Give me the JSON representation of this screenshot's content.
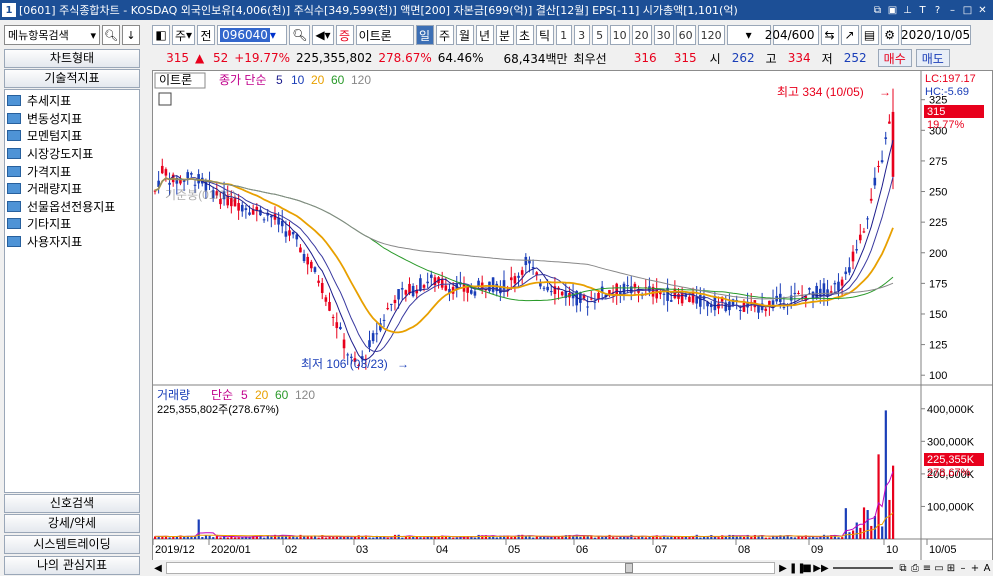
{
  "window": {
    "number": "1",
    "title": "[0601] 주식종합차트 - KOSDAQ 외국인보유[4,006(천)] 주식수[349,599(천)] 액면[200] 자본금[699(억)] 결산[12월] EPS[-11] 시가총액[1,101(억)"
  },
  "left_panel": {
    "menu_search_placeholder": "메뉴항목검색",
    "chart_type_label": "차트형태",
    "technical_label": "기술적지표",
    "tree_items": [
      "추세지표",
      "변동성지표",
      "모멘텀지표",
      "시장강도지표",
      "가격지표",
      "거래량지표",
      "선물옵션전용지표",
      "기타지표",
      "사용자지표"
    ],
    "signal_search": "신호검색",
    "strong_weak": "강세/약세",
    "system_trading": "시스템트레이딩",
    "my_indicators": "나의 관심지표"
  },
  "toolbar": {
    "ju": "주",
    "jeon": "전",
    "code": "096040",
    "name": "이트론",
    "jeung": "증",
    "periods": [
      "일",
      "주",
      "월",
      "년",
      "분",
      "초",
      "틱"
    ],
    "selected_period": "일",
    "intervals": [
      "1",
      "3",
      "5",
      "10",
      "20",
      "30",
      "60",
      "120"
    ],
    "count": "204/600",
    "date": "2020/10/05"
  },
  "quote": {
    "price": "315",
    "arrow": "▲",
    "change": "52",
    "change_pct": "+19.77%",
    "volume": "225,355,802",
    "vol_pct": "278.67%",
    "ratio": "64.46%",
    "amount": "68,434백만",
    "best_ask_label": "최우선",
    "best_ask": "316",
    "best_bid": "315",
    "open_label": "시",
    "open": "262",
    "high_label": "고",
    "high": "334",
    "low_label": "저",
    "low": "252",
    "buy_button": "매수",
    "sell_button": "매도"
  },
  "price_legend": {
    "name": "이트론",
    "base": "종가 단순",
    "ma": [
      "5",
      "10",
      "20",
      "60",
      "120"
    ]
  },
  "vol_legend": {
    "name": "거래량",
    "base": "단순",
    "ma": [
      "5",
      "20",
      "60",
      "120"
    ],
    "value": "225,355,802주(278.67%)"
  },
  "annotations": {
    "high_label": "최고 334 (10/05)",
    "low_label": "최저 106 (03/23)",
    "lc": "LC:197.17",
    "hc": "HC:-5.69",
    "price_tag": "315",
    "price_pct_tag": "19.77%",
    "vol_tag": "225,355K",
    "vol_pct_tag": "278.67%",
    "ghost_label": "기준봉(01/03)"
  },
  "axis": {
    "price_ticks": [
      325,
      300,
      275,
      250,
      225,
      200,
      175,
      150,
      125,
      100
    ],
    "vol_ticks": [
      "400,000K",
      "300,000K",
      "200,000K",
      "100,000K"
    ],
    "x_labels": [
      "2019/12",
      "2020/01",
      "02",
      "03",
      "04",
      "05",
      "06",
      "07",
      "08",
      "09",
      "10",
      "10/05"
    ]
  },
  "colors": {
    "up": "#e8001c",
    "down": "#1a3eb8",
    "ma5": "#1c1c8c",
    "ma10": "#1c1c8c",
    "ma20": "#e8a000",
    "ma60": "#2a9a2a",
    "ma120": "#888888"
  }
}
